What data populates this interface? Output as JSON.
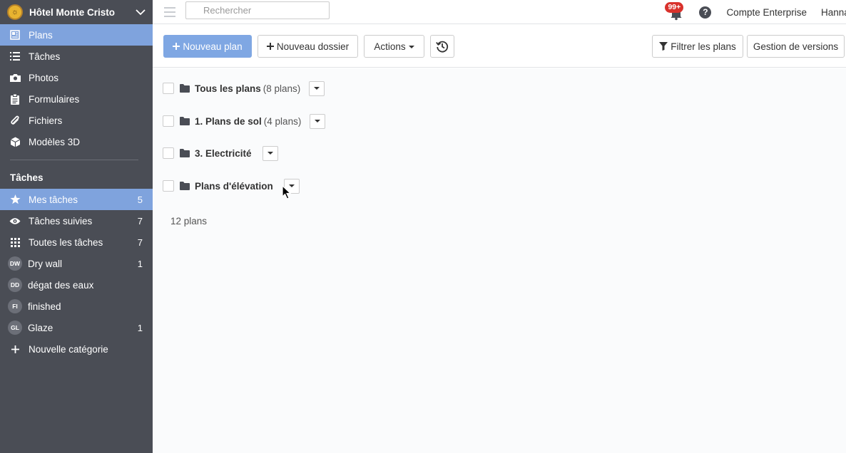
{
  "sidebar": {
    "project": "Hôtel Monte Cristo",
    "nav": [
      {
        "label": "Plans",
        "icon": "plans-icon"
      },
      {
        "label": "Tâches",
        "icon": "list-icon"
      },
      {
        "label": "Photos",
        "icon": "camera-icon"
      },
      {
        "label": "Formulaires",
        "icon": "clipboard-icon"
      },
      {
        "label": "Fichiers",
        "icon": "paperclip-icon"
      },
      {
        "label": "Modèles 3D",
        "icon": "cube-icon"
      }
    ],
    "section_title": "Tâches",
    "tasks": [
      {
        "label": "Mes tâches",
        "count": "5"
      },
      {
        "label": "Tâches suivies",
        "count": "7"
      },
      {
        "label": "Toutes les tâches",
        "count": "7"
      },
      {
        "label": "Dry wall",
        "count": "1",
        "badge": "DW"
      },
      {
        "label": "dégat des eaux",
        "count": "",
        "badge": "DD"
      },
      {
        "label": "finished",
        "count": "",
        "badge": "FI"
      },
      {
        "label": "Glaze",
        "count": "1",
        "badge": "GL"
      },
      {
        "label": "Nouvelle catégorie",
        "count": ""
      }
    ]
  },
  "topbar": {
    "search_placeholder": "Rechercher",
    "notifications": "99+",
    "help": "?",
    "account": "Compte Enterprise",
    "user": "Hannah"
  },
  "toolbar": {
    "new_plan": "Nouveau plan",
    "new_folder": "Nouveau dossier",
    "actions": "Actions",
    "filter": "Filtrer les plans",
    "versions": "Gestion de versions"
  },
  "folders": [
    {
      "name": "Tous les plans",
      "count": "(8 plans)"
    },
    {
      "name": "1. Plans de sol",
      "count": "(4 plans)"
    },
    {
      "name": "3. Electricité",
      "count": ""
    },
    {
      "name": "Plans d'élévation",
      "count": ""
    }
  ],
  "total": "12 plans",
  "colors": {
    "sidebar": "#4a4d55",
    "active": "#7fa3dd",
    "primary": "#7fa7e3",
    "badge": "#d9322c"
  }
}
